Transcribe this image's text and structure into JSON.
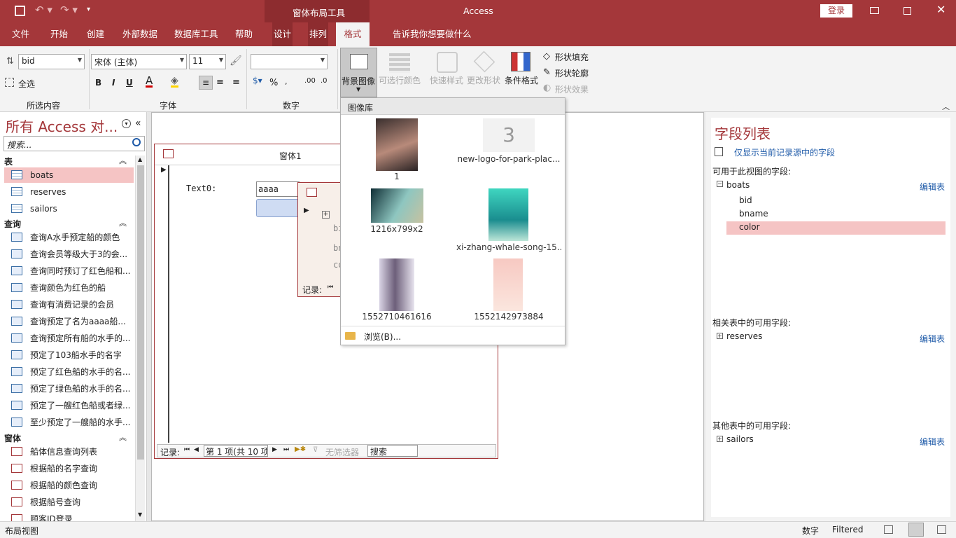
{
  "title": {
    "tool_context": "窗体布局工具",
    "app": "Access",
    "login": "登录"
  },
  "menu": {
    "file": "文件",
    "home": "开始",
    "create": "创建",
    "external": "外部数据",
    "dbtools": "数据库工具",
    "help": "帮助",
    "design": "设计",
    "arrange": "排列",
    "format": "格式",
    "tellme": "告诉我你想要做什么"
  },
  "ribbon": {
    "selection": {
      "field": "bid",
      "select_all": "全选",
      "group": "所选内容"
    },
    "font": {
      "name": "宋体 (主体)",
      "size": "11",
      "bold": "B",
      "italic": "I",
      "underline": "U",
      "group": "字体"
    },
    "number": {
      "group": "数字",
      "percent": "%"
    },
    "background": {
      "bg_image": "背景图像",
      "alt_row": "可选行颜色"
    },
    "controls": {
      "quick_style": "快速样式",
      "change_shape": "更改形状",
      "cond_format": "条件格式",
      "shape_fill": "形状填充",
      "shape_outline": "形状轮廓",
      "shape_effect": "形状效果"
    }
  },
  "gallery": {
    "header": "图像库",
    "items": [
      "1",
      "new-logo-for-park-plac...",
      "1216x799x2",
      "xi-zhang-whale-song-15...",
      "1552710461616",
      "1552142973884"
    ],
    "browse": "浏览(B)..."
  },
  "nav": {
    "title": "所有 Access 对...",
    "search_placeholder": "搜索...",
    "sections": {
      "tables": "表",
      "queries": "查询",
      "forms": "窗体"
    },
    "tables": [
      "boats",
      "reserves",
      "sailors"
    ],
    "queries": [
      "查询A水手预定船的颜色",
      "查询会员等级大于3的会...",
      "查询同时预订了红色船和...",
      "查询颜色为红色的船",
      "查询有消费记录的会员",
      "查询预定了名为aaaa船...",
      "查询预定所有船的水手的...",
      "预定了103船水手的名字",
      "预定了红色船的水手的名...",
      "预定了绿色船的水手的名...",
      "预定了一艘红色船或者绿...",
      "至少预定了一艘船的水手..."
    ],
    "forms": [
      "船体信息查询列表",
      "根据船的名字查询",
      "根据船的颜色查询",
      "根据船号查询",
      "顾客ID登录"
    ]
  },
  "form": {
    "tab": "窗体1",
    "text_label": "Text0:",
    "text_value": "aaaa",
    "sub_fields": [
      "bi",
      "bn",
      "co"
    ],
    "sub_record": "记录:",
    "record_label": "记录:",
    "record_pos": "第 1 项(共 10 项",
    "no_filter": "无筛选器",
    "search": "搜索"
  },
  "fieldlist": {
    "title": "字段列表",
    "only_current": "仅显示当前记录源中的字段",
    "available": "可用于此视图的字段:",
    "boats": "boats",
    "edit": "编辑表",
    "fields": [
      "bid",
      "bname",
      "color"
    ],
    "related": "相关表中的可用字段:",
    "reserves": "reserves",
    "others": "其他表中的可用字段:",
    "sailors": "sailors"
  },
  "status": {
    "view": "布局视图",
    "num": "数字",
    "filtered": "Filtered"
  },
  "colors": {
    "accent": "#a4373a",
    "selection": "#f5c4c4"
  }
}
